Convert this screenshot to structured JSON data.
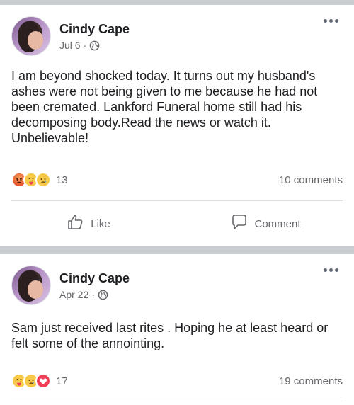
{
  "posts": [
    {
      "author": "Cindy Cape",
      "date": "Jul 6",
      "separator": "·",
      "privacy_icon": "globe-icon",
      "text": "I am beyond  shocked today. It turns out my husband's ashes were not being given to me because he had not been cremated.  Lankford Funeral home still had his decomposing body.Read the news or watch it. Unbelievable!",
      "reactions": [
        "angry",
        "care",
        "sad"
      ],
      "reaction_count": "13",
      "comments": "10 comments",
      "actions": {
        "like": "Like",
        "comment": "Comment"
      }
    },
    {
      "author": "Cindy Cape",
      "date": "Apr 22",
      "separator": "·",
      "privacy_icon": "globe-icon",
      "text": "Sam just received last rites . Hoping he at least heard or felt some of the annointing.",
      "reactions": [
        "care",
        "sad",
        "love"
      ],
      "reaction_count": "17",
      "comments": "19 comments"
    }
  ],
  "colors": {
    "separator": "#c9ccd1",
    "secondary_text": "#65676b",
    "primary_text": "#1c1e21"
  }
}
